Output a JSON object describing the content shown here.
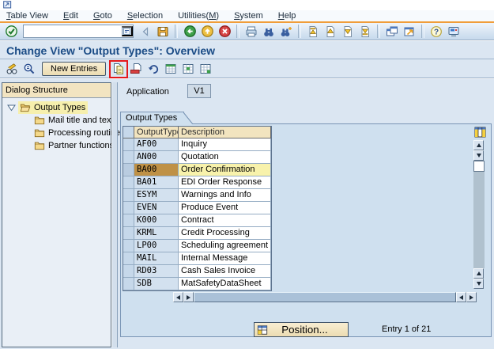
{
  "titlebar": {
    "window_icon": "window-flag-icon"
  },
  "menubar": {
    "items": [
      {
        "label": "Table View",
        "u": 0
      },
      {
        "label": "Edit",
        "u": 0
      },
      {
        "label": "Goto",
        "u": 0
      },
      {
        "label": "Selection",
        "u": 0
      },
      {
        "label": "Utilities(M)",
        "u": 10
      },
      {
        "label": "System",
        "u": 0
      },
      {
        "label": "Help",
        "u": 0
      }
    ]
  },
  "toolbar": {
    "command_value": "",
    "icons": [
      "back-triangle-icon",
      "save-icon",
      "sep",
      "back-icon",
      "exit-icon",
      "cancel-icon",
      "sep",
      "print-icon",
      "find-icon",
      "find-next-icon",
      "sep",
      "first-page-icon",
      "page-up-icon",
      "page-down-icon",
      "last-page-icon",
      "sep",
      "new-session-icon",
      "shortcut-icon",
      "sep",
      "help-icon",
      "customize-icon"
    ]
  },
  "title": {
    "text": "Change View \"Output Types\": Overview"
  },
  "app_toolbar": {
    "new_entries_label": "New Entries",
    "items": [
      {
        "type": "icon",
        "name": "display-change-icon"
      },
      {
        "type": "icon",
        "name": "overview-icon"
      },
      {
        "type": "button",
        "name": "new-entries-button",
        "label": "New Entries"
      },
      {
        "type": "icon",
        "name": "copy-icon",
        "highlighted": true
      },
      {
        "type": "icon",
        "name": "delete-line-icon"
      },
      {
        "type": "icon",
        "name": "undo-icon"
      },
      {
        "type": "icon",
        "name": "select-all-icon"
      },
      {
        "type": "icon",
        "name": "select-block-icon"
      },
      {
        "type": "icon",
        "name": "deselect-all-icon"
      }
    ]
  },
  "sidebar": {
    "header": "Dialog Structure",
    "tree": [
      {
        "label": "Output Types",
        "level": 0,
        "expanded": true,
        "selected": true,
        "icon": "folder-open-icon"
      },
      {
        "label": "Mail title and texts",
        "level": 1,
        "icon": "folder-icon"
      },
      {
        "label": "Processing routine:",
        "level": 1,
        "icon": "folder-icon"
      },
      {
        "label": "Partner functions",
        "level": 1,
        "icon": "folder-icon"
      }
    ]
  },
  "main": {
    "application_label": "Application",
    "application_value": "V1",
    "groupbox_title": "Output Types",
    "table": {
      "columns": [
        "OutputType",
        "Description"
      ],
      "rows": [
        [
          "AF00",
          "Inquiry"
        ],
        [
          "AN00",
          "Quotation"
        ],
        [
          "BA00",
          "Order Confirmation"
        ],
        [
          "BA01",
          "EDI Order Response"
        ],
        [
          "ESYM",
          "Warnings and Info"
        ],
        [
          "EVEN",
          "Produce Event"
        ],
        [
          "K000",
          "Contract"
        ],
        [
          "KRML",
          "Credit Processing"
        ],
        [
          "LP00",
          "Scheduling agreement"
        ],
        [
          "MAIL",
          "Internal Message"
        ],
        [
          "RD03",
          "Cash Sales Invoice"
        ],
        [
          "SDB",
          "MatSafetyDataSheet"
        ]
      ],
      "selected_row": 2
    },
    "position_button_label": "Position...",
    "entry_counter": "Entry 1 of 21"
  },
  "colors": {
    "window_bg": "#dbe6f2",
    "orange_separator": "#f09d3a",
    "title_blue": "#1b4c86",
    "header_tan": "#f2e4bf",
    "groupbox_bg": "#cfe0ef",
    "row_code_bg": "#d3e1ef",
    "selected_gold": "#bf9146",
    "selected_yellow": "#f8f2ab",
    "tree_selected": "#f6efad",
    "red_annotation": "#e5181b",
    "button_tan": "#f3e6c4"
  }
}
